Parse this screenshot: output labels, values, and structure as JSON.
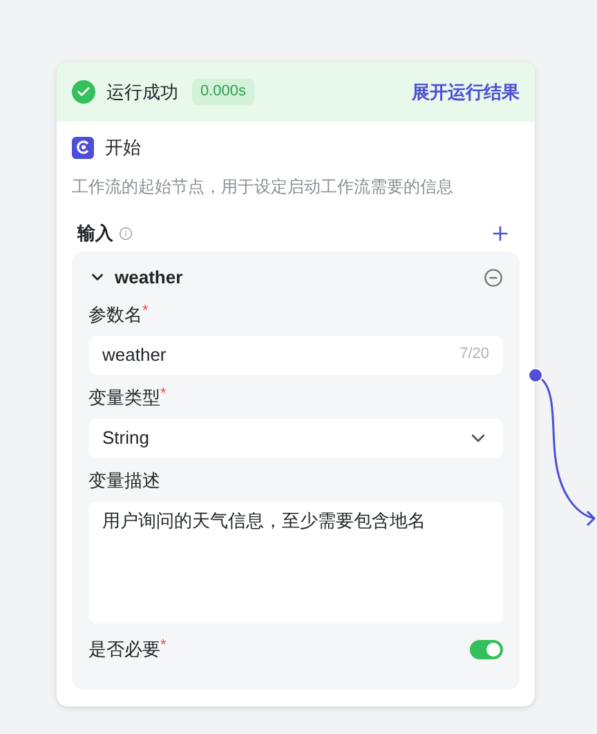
{
  "status": {
    "text": "运行成功",
    "duration": "0.000s",
    "link": "展开运行结果"
  },
  "node": {
    "title": "开始",
    "description": "工作流的起始节点，用于设定启动工作流需要的信息"
  },
  "inputs": {
    "label": "输入",
    "params": [
      {
        "name": "weather",
        "expanded": true,
        "fields": [
          {
            "kind": "text",
            "label": "参数名",
            "required_mark": "*",
            "value": "weather",
            "count": "7/20"
          },
          {
            "kind": "select",
            "label": "变量类型",
            "required_mark": "*",
            "value": "String"
          },
          {
            "kind": "textarea",
            "label": "变量描述",
            "value": "用户询问的天气信息，至少需要包含地名"
          },
          {
            "kind": "switch",
            "label": "是否必要",
            "required_mark": "*",
            "on": true
          }
        ]
      }
    ]
  }
}
